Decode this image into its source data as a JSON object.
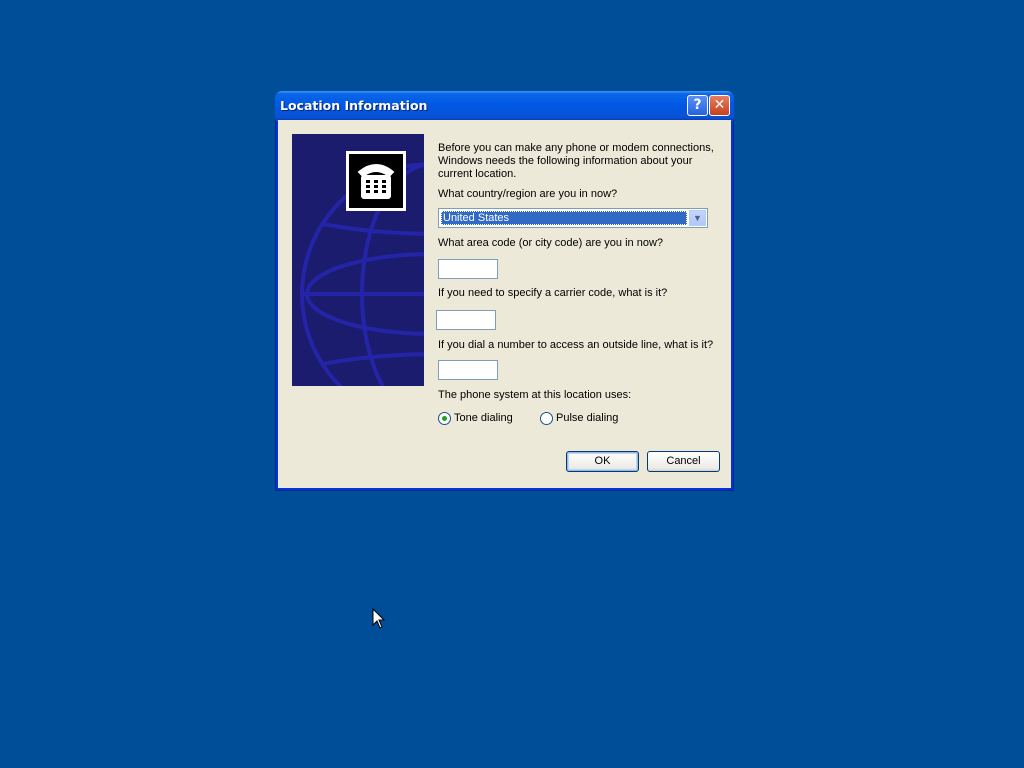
{
  "dialog": {
    "title": "Location Information",
    "help_button": "?",
    "close_button": "✕"
  },
  "content": {
    "intro": "Before you can make any phone or modem connections, Windows needs the following information about your current location.",
    "country_label": "What country/region are you in now?",
    "country_value": "United States",
    "area_code_label": "What area code (or city code) are you in now?",
    "area_code_value": "",
    "carrier_label": "If you need to specify a carrier code, what is it?",
    "carrier_value": "",
    "outside_line_label": "If you dial a number to access an outside line, what is it?",
    "outside_line_value": "",
    "phone_system_label": "The phone system at this location uses:",
    "tone_label": "Tone dialing",
    "pulse_label": "Pulse dialing",
    "selected_dialing": "tone"
  },
  "buttons": {
    "ok": "OK",
    "cancel": "Cancel"
  },
  "colors": {
    "desktop": "#004e98",
    "dialog_face": "#ece9d8",
    "selection": "#316ac5"
  }
}
